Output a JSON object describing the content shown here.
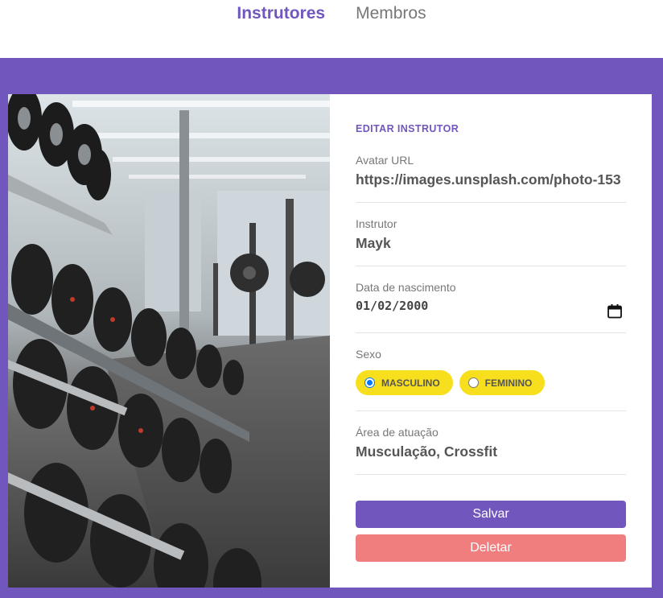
{
  "nav": {
    "instrutores": "Instrutores",
    "membros": "Membros"
  },
  "form": {
    "title": "EDITAR INSTRUTOR",
    "avatar_label": "Avatar URL",
    "avatar_value": "https://images.unsplash.com/photo-153",
    "instrutor_label": "Instrutor",
    "instrutor_value": "Mayk",
    "nascimento_label": "Data de nascimento",
    "nascimento_value": "01/02/2000",
    "sexo_label": "Sexo",
    "sexo_options": [
      {
        "label": "MASCULINO",
        "checked": true
      },
      {
        "label": "FEMININO",
        "checked": false
      }
    ],
    "area_label": "Área de atuação",
    "area_value": "Musculação, Crossfit",
    "save_label": "Salvar",
    "delete_label": "Deletar"
  },
  "colors": {
    "accent": "#7156bd",
    "radio_pill": "#f7df1e",
    "delete": "#f07e7e"
  },
  "icons": {
    "calendar": "calendar-icon",
    "photo": "gym-dumbbell-rack-photo"
  }
}
